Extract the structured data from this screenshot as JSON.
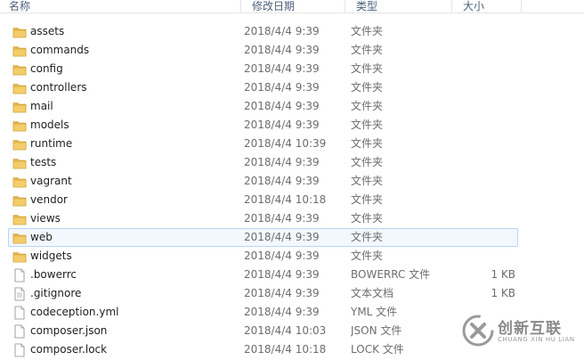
{
  "columns": {
    "name": "名称",
    "date": "修改日期",
    "type": "类型",
    "size": "大小"
  },
  "files": [
    {
      "name": "assets",
      "date": "2018/4/4 9:39",
      "type": "文件夹",
      "size": "",
      "icon": "folder-icon"
    },
    {
      "name": "commands",
      "date": "2018/4/4 9:39",
      "type": "文件夹",
      "size": "",
      "icon": "folder-icon"
    },
    {
      "name": "config",
      "date": "2018/4/4 9:39",
      "type": "文件夹",
      "size": "",
      "icon": "folder-icon"
    },
    {
      "name": "controllers",
      "date": "2018/4/4 9:39",
      "type": "文件夹",
      "size": "",
      "icon": "folder-icon"
    },
    {
      "name": "mail",
      "date": "2018/4/4 9:39",
      "type": "文件夹",
      "size": "",
      "icon": "folder-icon"
    },
    {
      "name": "models",
      "date": "2018/4/4 9:39",
      "type": "文件夹",
      "size": "",
      "icon": "folder-icon"
    },
    {
      "name": "runtime",
      "date": "2018/4/4 10:39",
      "type": "文件夹",
      "size": "",
      "icon": "folder-icon"
    },
    {
      "name": "tests",
      "date": "2018/4/4 9:39",
      "type": "文件夹",
      "size": "",
      "icon": "folder-icon"
    },
    {
      "name": "vagrant",
      "date": "2018/4/4 9:39",
      "type": "文件夹",
      "size": "",
      "icon": "folder-icon"
    },
    {
      "name": "vendor",
      "date": "2018/4/4 10:18",
      "type": "文件夹",
      "size": "",
      "icon": "folder-icon"
    },
    {
      "name": "views",
      "date": "2018/4/4 9:39",
      "type": "文件夹",
      "size": "",
      "icon": "folder-icon"
    },
    {
      "name": "web",
      "date": "2018/4/4 9:39",
      "type": "文件夹",
      "size": "",
      "icon": "folder-icon",
      "hover": true
    },
    {
      "name": "widgets",
      "date": "2018/4/4 9:39",
      "type": "文件夹",
      "size": "",
      "icon": "folder-icon"
    },
    {
      "name": ".bowerrc",
      "date": "2018/4/4 9:39",
      "type": "BOWERRC 文件",
      "size": "1 KB",
      "icon": "file-icon"
    },
    {
      "name": ".gitignore",
      "date": "2018/4/4 9:39",
      "type": "文本文档",
      "size": "1 KB",
      "icon": "text-file-icon"
    },
    {
      "name": "codeception.yml",
      "date": "2018/4/4 9:39",
      "type": "YML 文件",
      "size": "",
      "icon": "file-icon"
    },
    {
      "name": "composer.json",
      "date": "2018/4/4 10:03",
      "type": "JSON 文件",
      "size": "",
      "icon": "file-icon"
    },
    {
      "name": "composer.lock",
      "date": "2018/4/4 10:18",
      "type": "LOCK 文件",
      "size": "",
      "icon": "file-icon"
    }
  ],
  "watermark": {
    "name_cn": "创新互联",
    "name_en": "CHUANG XIN HU LIAN"
  },
  "colors": {
    "folder": "#e8b84a",
    "hover_border": "#b6d6f7",
    "header_text": "#4c607a"
  }
}
